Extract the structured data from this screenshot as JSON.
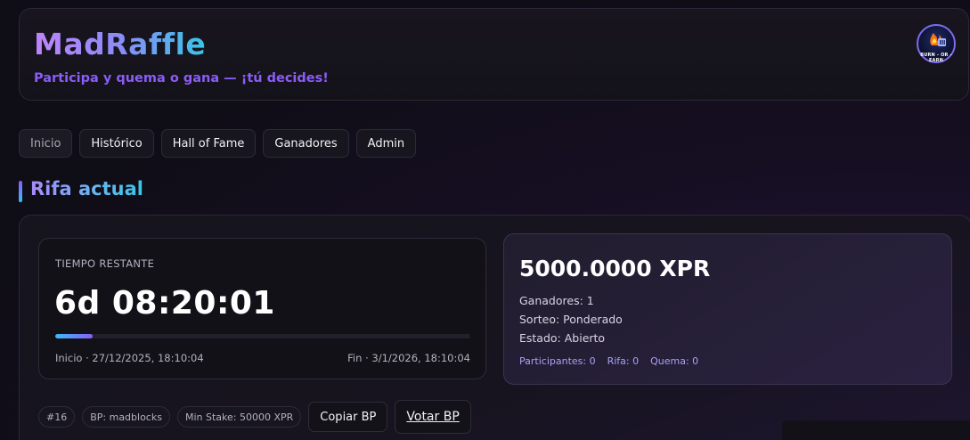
{
  "header": {
    "title": "MadRaffle",
    "subtitle": "Participa y quema o gana — ¡tú decides!",
    "logo_text": "BURN - OR - EARN",
    "logo_icon": "flame-coin-icon"
  },
  "nav": {
    "items": [
      {
        "label": "Inicio",
        "active": true
      },
      {
        "label": "Histórico",
        "active": false
      },
      {
        "label": "Hall of Fame",
        "active": false
      },
      {
        "label": "Ganadores",
        "active": false
      },
      {
        "label": "Admin",
        "active": false
      }
    ]
  },
  "section": {
    "title": "Rifa actual"
  },
  "raffle": {
    "time_label": "TIEMPO RESTANTE",
    "time_remaining": "6d 08:20:01",
    "progress_fraction": 0.09,
    "start": "Inicio · 27/12/2025, 18:10:04",
    "end": "Fin · 3/1/2026, 18:10:04",
    "prize": "5000.0000 XPR",
    "winners": "Ganadores: 1",
    "draw": "Sorteo: Ponderado",
    "status": "Estado: Abierto",
    "stats": {
      "participants": "Participantes: 0",
      "raffle": "Rifa: 0",
      "burn": "Quema: 0"
    },
    "chips": {
      "id": "#16",
      "bp": "BP: madblocks",
      "min_stake": "Min Stake: 50000 XPR"
    },
    "buttons": {
      "copy": "Copiar BP",
      "vote": "Votar BP"
    }
  },
  "colors": {
    "accent_purple": "#8b5cf6",
    "accent_cyan": "#38bdf8",
    "background": "#0f0d16"
  }
}
